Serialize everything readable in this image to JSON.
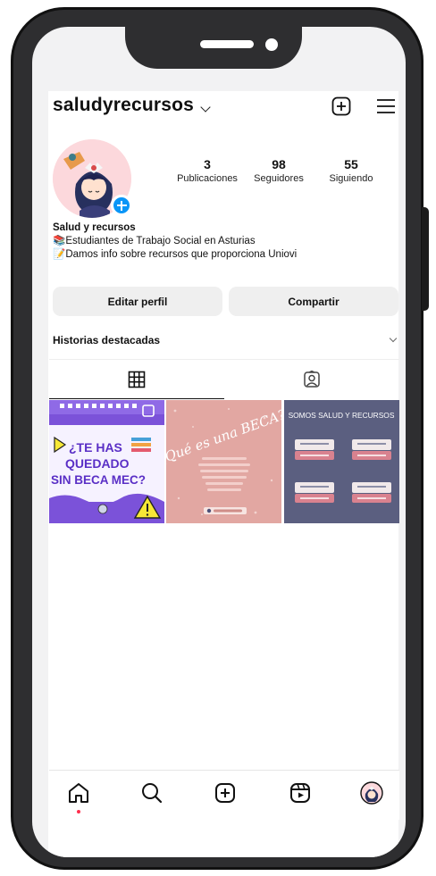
{
  "profile": {
    "username": "saludyrecursos",
    "display_name": "Salud y recursos",
    "bio_lines": [
      "Estudiantes de Trabajo Social en Asturias",
      "Damos info sobre recursos que proporciona Uniovi"
    ],
    "bio_emojis": [
      "📚",
      "📝"
    ]
  },
  "stats": [
    {
      "value": "3",
      "label": "Publicaciones"
    },
    {
      "value": "98",
      "label": "Seguidores"
    },
    {
      "value": "55",
      "label": "Siguiendo"
    }
  ],
  "buttons": {
    "edit": "Editar perfil",
    "share": "Compartir"
  },
  "highlights": {
    "title": "Historias destacadas"
  },
  "posts": [
    {
      "lines": [
        "¿TE HAS",
        "QUEDADO",
        "SIN BECA MEC?"
      ],
      "bg": "#7b52d9"
    },
    {
      "title": "¿Qué es una BECA?",
      "bg": "#e2a7a2"
    },
    {
      "title": "SOMOS SALUD Y RECURSOS",
      "bg": "#5b5f80",
      "card_color": "#d9828f"
    }
  ],
  "colors": {
    "accent": "#0a95f7",
    "notification_dot": "#ff2e4d",
    "button_bg": "#efefef"
  },
  "nav": [
    "home-icon",
    "search-icon",
    "create-icon",
    "reels-icon",
    "profile-avatar"
  ]
}
